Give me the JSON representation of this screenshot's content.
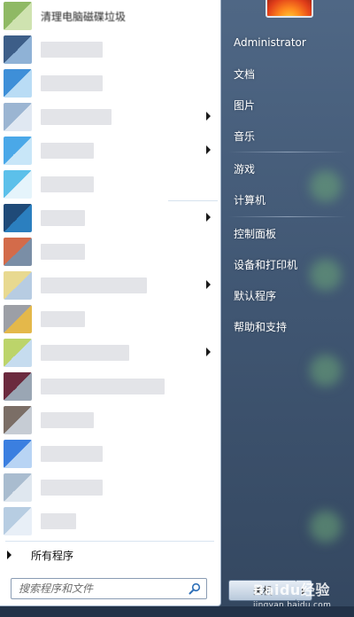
{
  "program_list": {
    "first_item_label": "清理电脑磁碟垃圾",
    "items": [
      {
        "label_width": 100,
        "colors": [
          "#8fb964",
          "#cfe3b0"
        ],
        "has_submenu": false
      },
      {
        "label_width": 70,
        "colors": [
          "#3d5e88",
          "#8fb2d6"
        ],
        "has_submenu": false
      },
      {
        "label_width": 70,
        "colors": [
          "#3e8fd8",
          "#b9dcf5"
        ],
        "has_submenu": false
      },
      {
        "label_width": 80,
        "colors": [
          "#9bb5d2",
          "#e0e8f2"
        ],
        "has_submenu": true
      },
      {
        "label_width": 60,
        "colors": [
          "#4aa8e8",
          "#c8e6f8"
        ],
        "has_submenu": true
      },
      {
        "label_width": 60,
        "colors": [
          "#5cc0ea",
          "#e5f4fb"
        ],
        "has_submenu": false
      },
      {
        "label_width": 50,
        "colors": [
          "#1f4a78",
          "#2b7fbf"
        ],
        "has_submenu": true
      },
      {
        "label_width": 50,
        "colors": [
          "#d36b4a",
          "#7a8ea6"
        ],
        "has_submenu": false
      },
      {
        "label_width": 120,
        "colors": [
          "#e8d990",
          "#b7cce2"
        ],
        "has_submenu": true
      },
      {
        "label_width": 50,
        "colors": [
          "#9c9fa6",
          "#e4b84a"
        ],
        "has_submenu": false
      },
      {
        "label_width": 100,
        "colors": [
          "#bcd46a",
          "#c6dcef"
        ],
        "has_submenu": true
      },
      {
        "label_width": 140,
        "colors": [
          "#6b2a3e",
          "#9aa6b4"
        ],
        "has_submenu": false
      },
      {
        "label_width": 60,
        "colors": [
          "#7b6e66",
          "#c6ccd4"
        ],
        "has_submenu": false
      },
      {
        "label_width": 70,
        "colors": [
          "#3b7fe0",
          "#b8d4f4"
        ],
        "has_submenu": false
      },
      {
        "label_width": 70,
        "colors": [
          "#a9bccf",
          "#dfe7ef"
        ],
        "has_submenu": false
      },
      {
        "label_width": 40,
        "colors": [
          "#b7cde2",
          "#e8eff7"
        ],
        "has_submenu": false
      }
    ]
  },
  "all_programs_label": "所有程序",
  "search": {
    "placeholder": "搜索程序和文件"
  },
  "right_menu": {
    "user": "Administrator",
    "documents": "文档",
    "pictures": "图片",
    "music": "音乐",
    "games": "游戏",
    "computer": "计算机",
    "control_panel": "控制面板",
    "devices_printers": "设备和打印机",
    "default_programs": "默认程序",
    "help_support": "帮助和支持"
  },
  "shutdown_label": "关机",
  "watermark": {
    "main": "Baidu经验",
    "sub": "jingyan.baidu.com"
  }
}
